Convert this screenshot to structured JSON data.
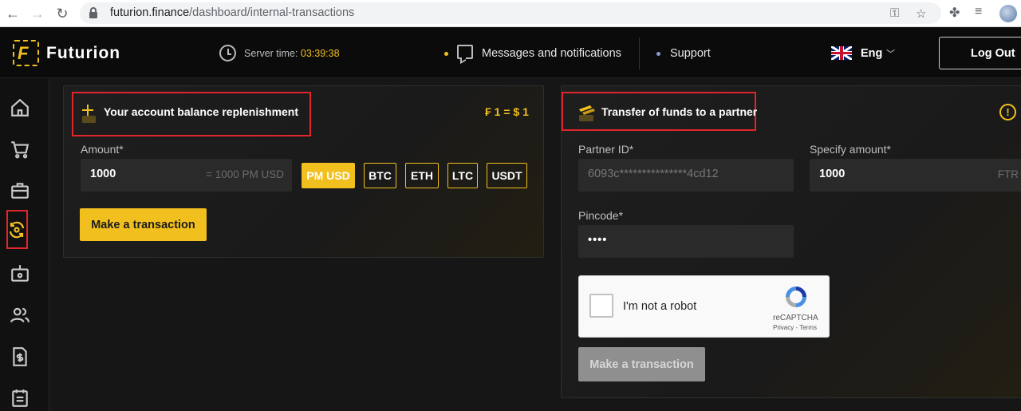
{
  "browser": {
    "url_domain": "futurion.finance",
    "url_path": "/dashboard/internal-transactions"
  },
  "header": {
    "logo_text": "Futurion",
    "server_time_label": "Server time:",
    "server_time_value": "03:39:38",
    "messages_label": "Messages and notifications",
    "support_label": "Support",
    "language": "Eng",
    "logout_label": "Log Out",
    "colors": {
      "accent": "#f2c01e",
      "support_dot": "#8a9bd4",
      "highlight": "#e0262c"
    }
  },
  "sidebar": {
    "items": [
      {
        "icon": "home-icon"
      },
      {
        "icon": "cart-icon"
      },
      {
        "icon": "briefcase-icon"
      },
      {
        "icon": "exchange-icon",
        "active": true
      },
      {
        "icon": "wallet-icon"
      },
      {
        "icon": "users-icon"
      },
      {
        "icon": "invoice-icon"
      },
      {
        "icon": "calendar-icon"
      }
    ]
  },
  "replenish": {
    "title": "Your account balance replenishment",
    "rate": "₣ 1 = $ 1",
    "amount_label": "Amount*",
    "amount_value": "1000",
    "amount_converted": "= 1000 PM USD",
    "currencies": [
      "PM USD",
      "BTC",
      "ETH",
      "LTC",
      "USDT"
    ],
    "selected_currency": "PM USD",
    "button_label": "Make a transaction"
  },
  "transfer": {
    "title": "Transfer of funds to a partner",
    "partner_id_label": "Partner ID*",
    "partner_id_value": "6093c***************4cd12",
    "amount_label": "Specify amount*",
    "amount_value": "1000",
    "amount_unit": "FTR",
    "pincode_label": "Pincode*",
    "pincode_value": "••••",
    "captcha": {
      "label": "I'm not a robot",
      "brand": "reCAPTCHA",
      "links": "Privacy - Terms"
    },
    "button_label": "Make a transaction"
  }
}
